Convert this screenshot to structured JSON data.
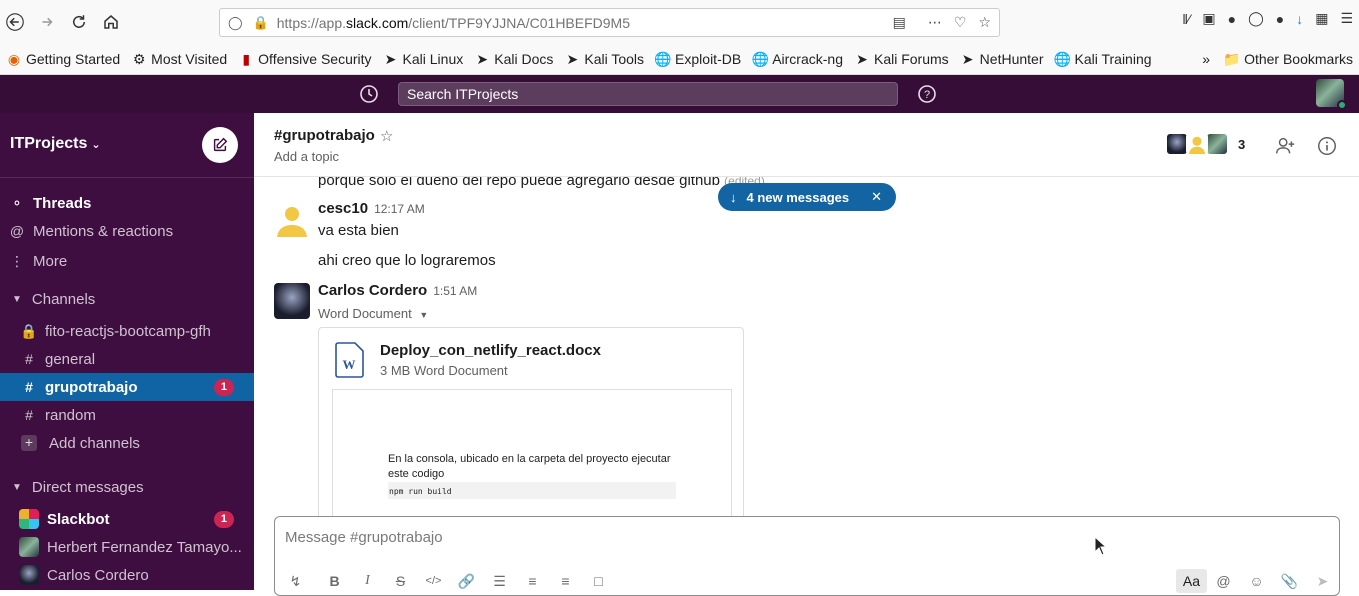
{
  "browser": {
    "url_prefix": "https://app.",
    "url_domain": "slack.com",
    "url_path": "/client/TPF9YJJNA/C01HBEFD9M5",
    "bookmarks": [
      "Getting Started",
      "Most Visited",
      "Offensive Security",
      "Kali Linux",
      "Kali Docs",
      "Kali Tools",
      "Exploit-DB",
      "Aircrack-ng",
      "Kali Forums",
      "NetHunter",
      "Kali Training"
    ],
    "other_bookmarks": "Other Bookmarks"
  },
  "slack": {
    "search_placeholder": "Search ITProjects",
    "workspace": "ITProjects",
    "nav": {
      "threads": "Threads",
      "mentions": "Mentions & reactions",
      "more": "More"
    },
    "channels_header": "Channels",
    "channels": [
      {
        "name": "fito-reactjs-bootcamp-gfh",
        "icon": "lock-icon"
      },
      {
        "name": "general",
        "icon": "hash-icon"
      },
      {
        "name": "grupotrabajo",
        "icon": "hash-icon",
        "badge": "1"
      },
      {
        "name": "random",
        "icon": "hash-icon"
      }
    ],
    "add_channels": "Add channels",
    "dm_header": "Direct messages",
    "dms": [
      {
        "name": "Slackbot",
        "badge": "1"
      },
      {
        "name": "Herbert Fernandez Tamayo..."
      },
      {
        "name": "Carlos Cordero"
      }
    ],
    "channel": {
      "name": "#grupotrabajo",
      "topic": "Add a topic",
      "member_count": "3"
    },
    "messages": {
      "cut_text": "porque solo el dueño del repo puede agregarlo desde github",
      "edited": "(edited)",
      "m1_author": "cesc10",
      "m1_time": "12:17 AM",
      "m1_text1": "va esta bien",
      "m1_text2": "ahi creo que lo lograremos",
      "m2_author": "Carlos Cordero",
      "m2_time": "1:51 AM",
      "file_type_label": "Word Document",
      "file_name": "Deploy_con_netlify_react.docx",
      "file_meta": "3 MB Word Document",
      "preview_text": "En la consola, ubicado en la carpeta del proyecto ejecutar este codigo",
      "preview_code": "npm run build"
    },
    "new_messages": "4 new messages",
    "composer_placeholder": "Message #grupotrabajo",
    "aa": "Aa"
  },
  "colors": {
    "aubergine_dark": "#350d36",
    "aubergine": "#3f0e40",
    "active_blue": "#1164a3",
    "badge_red": "#cd2553"
  }
}
